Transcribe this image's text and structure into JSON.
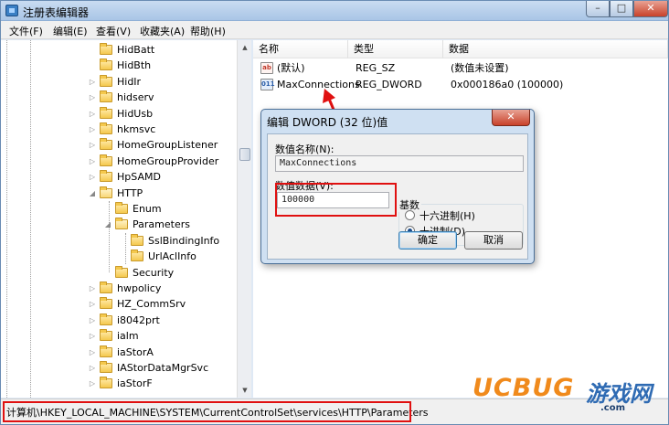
{
  "window": {
    "title": "注册表编辑器",
    "minimize": "–",
    "maximize": "□",
    "close": "✕"
  },
  "menu": [
    "文件(F)",
    "编辑(E)",
    "查看(V)",
    "收藏夹(A)",
    "帮助(H)"
  ],
  "tree": [
    {
      "label": "HidBatt",
      "level": 0,
      "expander": "",
      "open": false
    },
    {
      "label": "HidBth",
      "level": 0,
      "expander": "",
      "open": false
    },
    {
      "label": "HidIr",
      "level": 0,
      "expander": "▷",
      "open": false
    },
    {
      "label": "hidserv",
      "level": 0,
      "expander": "▷",
      "open": false
    },
    {
      "label": "HidUsb",
      "level": 0,
      "expander": "▷",
      "open": false
    },
    {
      "label": "hkmsvc",
      "level": 0,
      "expander": "▷",
      "open": false
    },
    {
      "label": "HomeGroupListener",
      "level": 0,
      "expander": "▷",
      "open": false
    },
    {
      "label": "HomeGroupProvider",
      "level": 0,
      "expander": "▷",
      "open": false
    },
    {
      "label": "HpSAMD",
      "level": 0,
      "expander": "▷",
      "open": false
    },
    {
      "label": "HTTP",
      "level": 0,
      "expander": "◢",
      "open": true
    },
    {
      "label": "Enum",
      "level": 1,
      "expander": "",
      "open": false
    },
    {
      "label": "Parameters",
      "level": 1,
      "expander": "◢",
      "open": true
    },
    {
      "label": "SslBindingInfo",
      "level": 2,
      "expander": "",
      "open": false
    },
    {
      "label": "UrlAclInfo",
      "level": 2,
      "expander": "",
      "open": false
    },
    {
      "label": "Security",
      "level": 1,
      "expander": "",
      "open": false
    },
    {
      "label": "hwpolicy",
      "level": 0,
      "expander": "▷",
      "open": false
    },
    {
      "label": "HZ_CommSrv",
      "level": 0,
      "expander": "▷",
      "open": false
    },
    {
      "label": "i8042prt",
      "level": 0,
      "expander": "▷",
      "open": false
    },
    {
      "label": "ialm",
      "level": 0,
      "expander": "▷",
      "open": false
    },
    {
      "label": "iaStorA",
      "level": 0,
      "expander": "▷",
      "open": false
    },
    {
      "label": "IAStorDataMgrSvc",
      "level": 0,
      "expander": "▷",
      "open": false
    },
    {
      "label": "iaStorF",
      "level": 0,
      "expander": "▷",
      "open": false
    }
  ],
  "list": {
    "columns": [
      "名称",
      "类型",
      "数据"
    ],
    "rows": [
      {
        "icon": "ab",
        "name": "(默认)",
        "type": "REG_SZ",
        "data": "(数值未设置)"
      },
      {
        "icon": "011",
        "name": "MaxConnections",
        "type": "REG_DWORD",
        "data": "0x000186a0 (100000)"
      }
    ]
  },
  "dialog": {
    "title": "编辑 DWORD (32 位)值",
    "close": "✕",
    "name_label": "数值名称(N):",
    "name_value": "MaxConnections",
    "data_label": "数值数据(V):",
    "data_value": "100000",
    "base_label": "基数",
    "hex_label": "十六进制(H)",
    "dec_label": "十进制(D)",
    "selected_base": "dec",
    "ok": "确定",
    "cancel": "取消"
  },
  "status": {
    "path": "计算机\\HKEY_LOCAL_MACHINE\\SYSTEM\\CurrentControlSet\\services\\HTTP\\Parameters"
  },
  "watermark": {
    "brand": "UCBUG",
    "cn": "游戏网",
    "url": ".com"
  },
  "colors": {
    "highlight": "#e01010",
    "watermark_orange": "#f08a1c",
    "watermark_blue": "#2f6bb3"
  }
}
